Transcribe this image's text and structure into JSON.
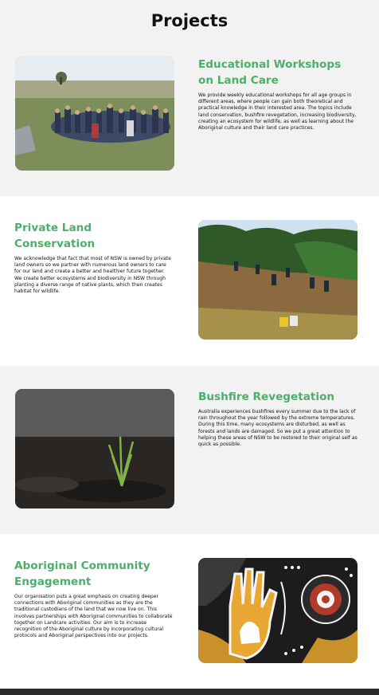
{
  "page": {
    "title": "Projects"
  },
  "projects": [
    {
      "title": "Educational Workshops on Land Care",
      "description": "We provide weekly educational workshops for all age groups in different areas, where people can gain both theoretical and practical knowledge in their interested area. The topics include land conservation, bushfire revegetation, increasing biodiversity, creating an ecosystem for wildlife, as well as learning about the Aboriginal culture and their land care practices."
    },
    {
      "title": "Private Land Conservation",
      "description": "We acknowledge that fact that most of NSW is owned by private land owners so we partner with numerous land owners to care for our land and create a better and healthier future together. We create better ecosystems and biodiversity in NSW through planting a diverse range of native plants, which then creates habitat for wildlife."
    },
    {
      "title": "Bushfire Revegetation",
      "description": "Australia experiences bushfires every summer due to the lack of rain throughout the year followed by the extreme temperatures. During this time, many ecosystems are disturbed, as well as forests and lands are damaged. So we put a great attention to helping these areas of NSW to be restored to their original self as quick as possible."
    },
    {
      "title": "Aboriginal Community Engagement",
      "description": "Our organisation puts a great emphasis on creating deeper connections with Aboriginal communities as they are the traditional custodians of the land that we now live on. This involves partnerships with Aboriginal communities to collaborate together on Landcare activities. Our aim is to increase recognition of the Aboriginal culture by incorporating cultural protocols and Aboriginal perspectives into our projects."
    }
  ]
}
